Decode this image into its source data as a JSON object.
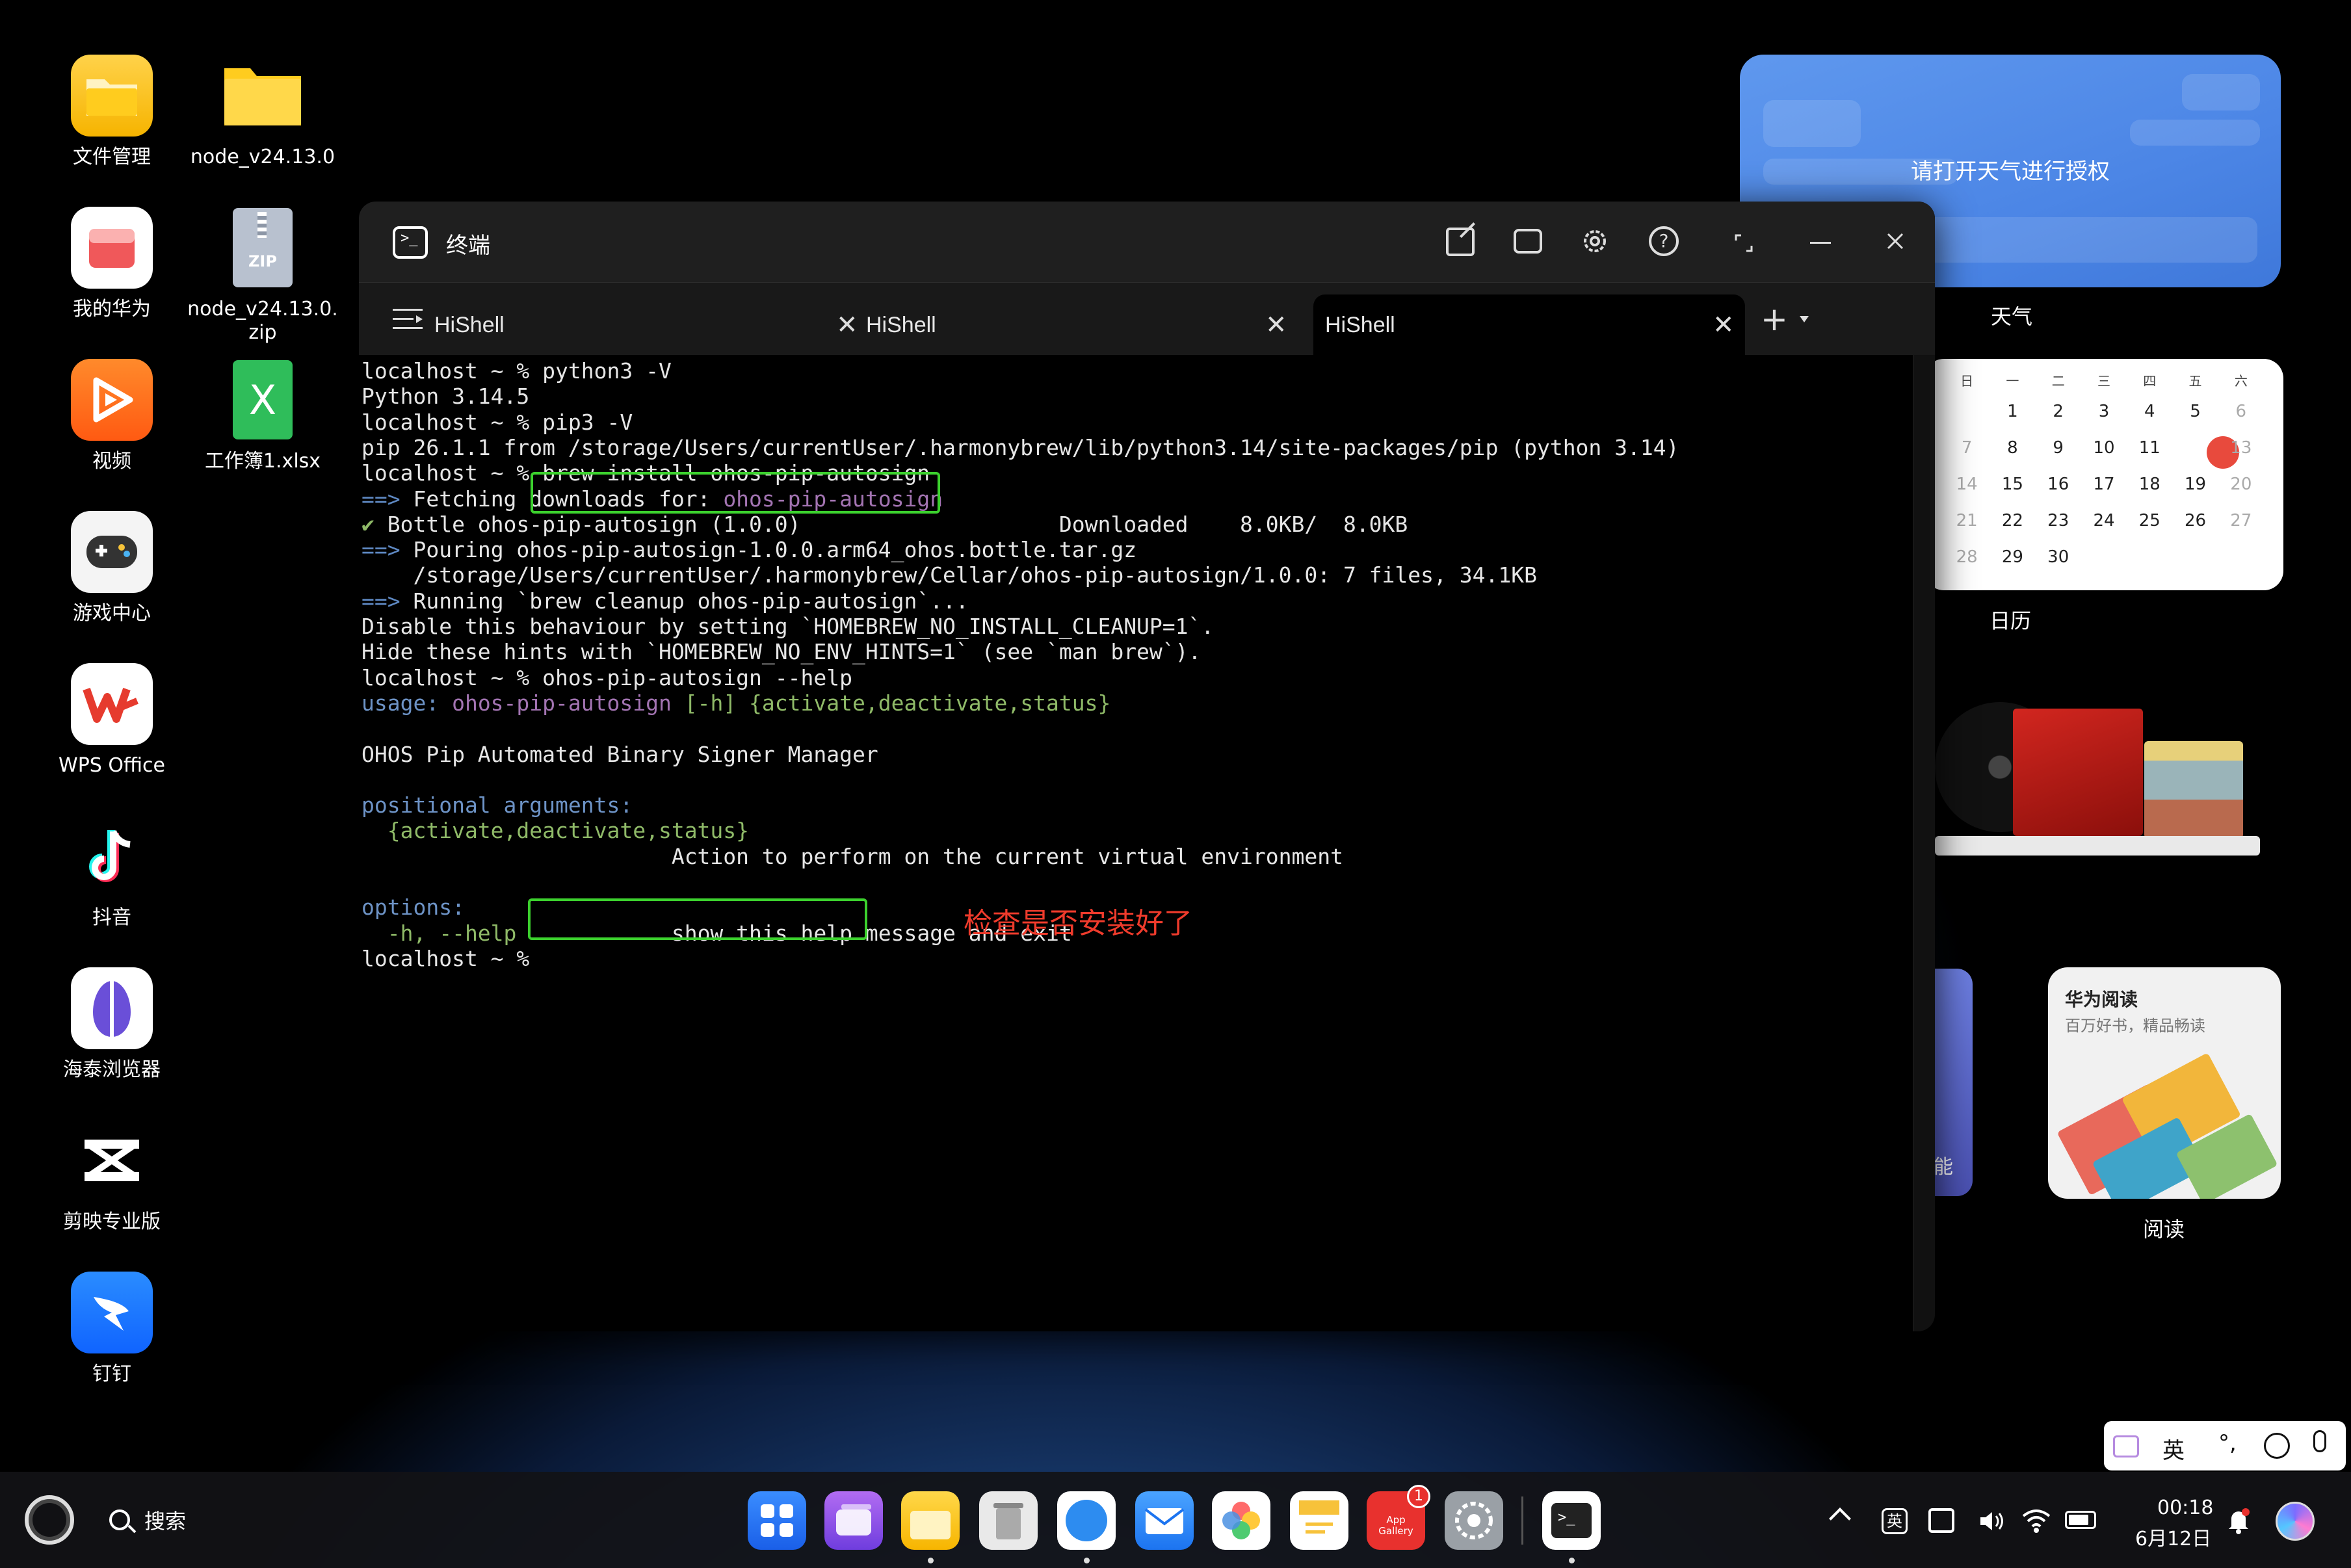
{
  "desktop": {
    "icons_col1": [
      {
        "label": "文件管理"
      },
      {
        "label": "我的华为"
      },
      {
        "label": "视频"
      },
      {
        "label": "游戏中心"
      },
      {
        "label": "WPS Office"
      },
      {
        "label": "抖音"
      },
      {
        "label": "海泰浏览器"
      },
      {
        "label": "剪映专业版"
      },
      {
        "label": "钉钉"
      }
    ],
    "icons_col2": [
      {
        "label": "node_v24.13.0"
      },
      {
        "label": "node_v24.13.0.\nzip",
        "badge": "ZIP"
      },
      {
        "label": "工作簿1.xlsx",
        "badge": "X"
      }
    ]
  },
  "widgets": {
    "weather": {
      "message": "请打开天气进行授权",
      "label": "天气"
    },
    "calendar": {
      "label": "日历",
      "weekdays": [
        "日",
        "一",
        "二",
        "三",
        "四",
        "五",
        "六"
      ],
      "rows": [
        [
          "",
          "1",
          "2",
          "3",
          "4",
          "5",
          "6"
        ],
        [
          "7",
          "8",
          "9",
          "10",
          "11",
          "12",
          "13"
        ],
        [
          "14",
          "15",
          "16",
          "17",
          "18",
          "19",
          "20"
        ],
        [
          "21",
          "22",
          "23",
          "24",
          "25",
          "26",
          "27"
        ],
        [
          "28",
          "29",
          "30",
          "",
          "",
          "",
          ""
        ]
      ],
      "today": "12"
    },
    "reading": {
      "title": "华为阅读",
      "subtitle": "百万好书，精品畅读",
      "label": "阅读"
    },
    "partial_text": "能"
  },
  "terminal": {
    "title": "终端",
    "tabs": [
      {
        "label": "HiShell"
      },
      {
        "label": "HiShell"
      },
      {
        "label": "HiShell"
      }
    ],
    "new_tab": "+",
    "lines": [
      {
        "parts": [
          {
            "t": "localhost ~ % python3 -V"
          }
        ]
      },
      {
        "parts": [
          {
            "t": "Python 3.14.5"
          }
        ]
      },
      {
        "parts": [
          {
            "t": "localhost ~ % pip3 -V"
          }
        ]
      },
      {
        "parts": [
          {
            "t": "pip 26.1.1 from /storage/Users/currentUser/.harmonybrew/lib/python3.14/site-packages/pip (python 3.14)"
          }
        ]
      },
      {
        "parts": [
          {
            "t": "localhost ~ % brew install ohos-pip-autosign"
          }
        ]
      },
      {
        "parts": [
          {
            "t": "==> ",
            "c": "arrow"
          },
          {
            "t": "Fetching downloads for: "
          },
          {
            "t": "ohos-pip-autosign",
            "c": "purple"
          }
        ]
      },
      {
        "parts": [
          {
            "t": "✔",
            "c": "green"
          },
          {
            "t": " Bottle ohos-pip-autosign (1.0.0)                    Downloaded    8.0KB/  8.0KB"
          }
        ]
      },
      {
        "parts": [
          {
            "t": "==> ",
            "c": "arrow"
          },
          {
            "t": "Pouring ohos-pip-autosign-1.0.0.arm64_ohos.bottle.tar.gz"
          }
        ]
      },
      {
        "parts": [
          {
            "t": "    /storage/Users/currentUser/.harmonybrew/Cellar/ohos-pip-autosign/1.0.0: 7 files, 34.1KB"
          }
        ]
      },
      {
        "parts": [
          {
            "t": "==> ",
            "c": "arrow"
          },
          {
            "t": "Running `brew cleanup ohos-pip-autosign`..."
          }
        ]
      },
      {
        "parts": [
          {
            "t": "Disable this behaviour by setting `HOMEBREW_NO_INSTALL_CLEANUP=1`."
          }
        ]
      },
      {
        "parts": [
          {
            "t": "Hide these hints with `HOMEBREW_NO_ENV_HINTS=1` (see `man brew`)."
          }
        ]
      },
      {
        "parts": [
          {
            "t": "localhost ~ % ohos-pip-autosign --help"
          }
        ]
      },
      {
        "parts": [
          {
            "t": "usage: ",
            "c": "blue"
          },
          {
            "t": "ohos-pip-autosign",
            "c": "purple"
          },
          {
            "t": " [-h] {activate,deactivate,status}",
            "c": "green"
          }
        ]
      },
      {
        "parts": [
          {
            "t": ""
          }
        ]
      },
      {
        "parts": [
          {
            "t": "OHOS Pip Automated Binary Signer Manager"
          }
        ]
      },
      {
        "parts": [
          {
            "t": ""
          }
        ]
      },
      {
        "parts": [
          {
            "t": "positional arguments:",
            "c": "blue"
          }
        ]
      },
      {
        "parts": [
          {
            "t": "  {activate,deactivate,status}",
            "c": "green"
          }
        ]
      },
      {
        "parts": [
          {
            "t": "                        Action to perform on the current virtual environment"
          }
        ]
      },
      {
        "parts": [
          {
            "t": ""
          }
        ]
      },
      {
        "parts": [
          {
            "t": "options:",
            "c": "blue"
          }
        ]
      },
      {
        "parts": [
          {
            "t": "  -h, --help",
            "c": "green"
          },
          {
            "t": "            show this help message and exit"
          }
        ]
      },
      {
        "parts": [
          {
            "t": "localhost ~ %"
          }
        ]
      }
    ],
    "annotation": "检查是否安装好了"
  },
  "taskbar": {
    "search_label": "搜索",
    "dock_apps": [
      "app-center",
      "multitask",
      "file-manager",
      "recycle-bin",
      "browser",
      "mail",
      "photos",
      "notes",
      "app-gallery",
      "settings",
      "terminal"
    ],
    "app_gallery_text": "App\nGallery",
    "app_gallery_badge": "1",
    "time": "00:18",
    "date": "6月12日",
    "ime_lang": "英",
    "tray_lang": "英"
  },
  "colors": {
    "terminal_highlight": "#3cd12e",
    "annotation": "#ef3b2c",
    "calendar_today": "#e84a3d",
    "weather_bg": "#4c86e6"
  }
}
